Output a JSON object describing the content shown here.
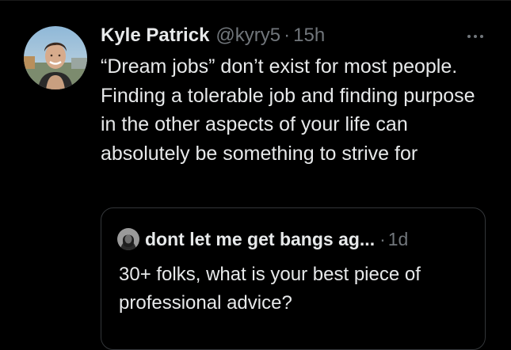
{
  "tweet": {
    "author": {
      "display_name": "Kyle Patrick",
      "handle": "@kyry5",
      "separator": "·",
      "time": "15h",
      "avatar_icon": "profile-photo"
    },
    "more_icon": "more-horizontal-icon",
    "text": "“Dream jobs” don’t exist for most people. Finding a tolerable job and finding purpose in the other aspects of your life can absolutely be something to strive for",
    "quote": {
      "author": {
        "display_name": "dont let me get bangs ag...",
        "separator": "·",
        "time": "1d",
        "avatar_icon": "profile-photo"
      },
      "text": "30+ folks, what is your best piece of professional advice?"
    }
  },
  "colors": {
    "background": "#000000",
    "primary_text": "#e7e9ea",
    "secondary_text": "#71767b",
    "border": "#333639"
  }
}
